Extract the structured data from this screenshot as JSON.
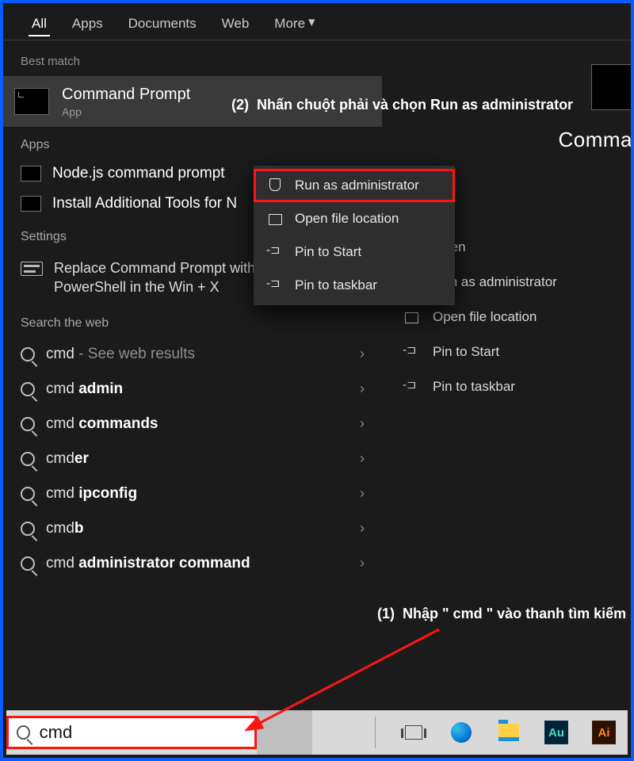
{
  "tabs": {
    "all": "All",
    "apps": "Apps",
    "documents": "Documents",
    "web": "Web",
    "more": "More"
  },
  "sections": {
    "best_match": "Best match",
    "apps": "Apps",
    "settings": "Settings",
    "search_web": "Search the web"
  },
  "best_match": {
    "title": "Command Prompt",
    "subtitle": "App"
  },
  "app_rows": {
    "node": "Node.js command prompt",
    "install": "Install Additional Tools for N"
  },
  "settings_item": "Replace Command Prompt with Windows PowerShell in the Win + X",
  "web": {
    "r0_pre": "cmd",
    "r0_sub": " - See web results",
    "r1_pre": "cmd ",
    "r1_bold": "admin",
    "r2_pre": "cmd ",
    "r2_bold": "commands",
    "r3_pre": "cmd",
    "r3_bold": "er",
    "r4_pre": "cmd ",
    "r4_bold": "ipconfig",
    "r5_pre": "cmd",
    "r5_bold": "b",
    "r6_pre": "cmd ",
    "r6_bold": "administrator command"
  },
  "ctx": {
    "run_admin": "Run as administrator",
    "open_loc": "Open file location",
    "pin_start": "Pin to Start",
    "pin_task": "Pin to taskbar"
  },
  "preview": {
    "title": "Comma"
  },
  "right_actions": {
    "open": "Open",
    "run_admin": "Run as administrator",
    "open_loc": "Open file location",
    "pin_start": "Pin to Start",
    "pin_task": "Pin to taskbar"
  },
  "annotations": {
    "step2_num": "(2)",
    "step2": "Nhấn chuột phải và chọn Run as administrator",
    "step1_num": "(1)",
    "step1": "Nhập \" cmd \" vào thanh tìm kiếm"
  },
  "search": {
    "value": "cmd"
  },
  "taskbar_apps": {
    "au": "Au",
    "ai": "Ai"
  }
}
